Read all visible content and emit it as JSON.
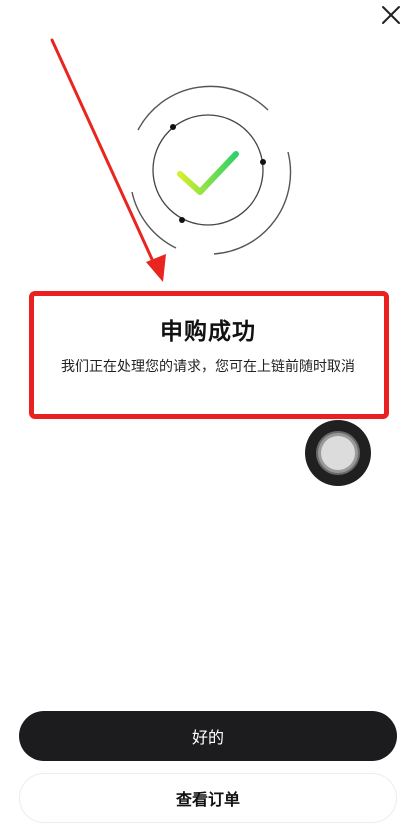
{
  "header": {
    "close_icon": "close-icon"
  },
  "result": {
    "title": "申购成功",
    "message": "我们正在处理您的请求，您可在上链前随时取消",
    "status_icon": "check-icon"
  },
  "colors": {
    "highlight": "#ea2020",
    "check_start": "#d6ef2c",
    "check_end": "#2fd06a",
    "primary_button": "#1c1c1f"
  },
  "actions": {
    "primary_label": "好的",
    "secondary_label": "查看订单"
  },
  "floating": {
    "icon": "assistive-touch-icon"
  }
}
